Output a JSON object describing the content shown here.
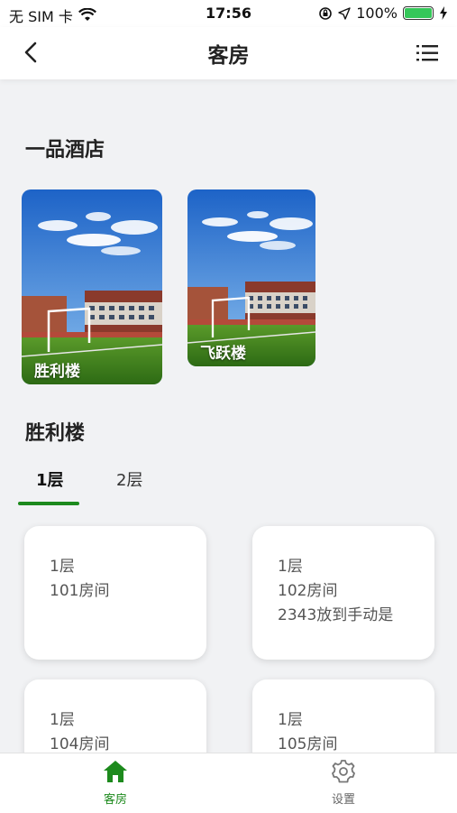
{
  "status_bar": {
    "carrier": "无 SIM 卡",
    "time": "17:56",
    "battery_percent": "100%",
    "battery_level": 1.0,
    "icons": [
      "wifi-icon",
      "location-icon",
      "lock-rotation-icon",
      "battery-icon",
      "charging-icon"
    ]
  },
  "nav": {
    "title": "客房",
    "back_icon": "chevron-left-icon",
    "menu_icon": "list-menu-icon"
  },
  "hotel": {
    "name": "一品酒店"
  },
  "buildings": [
    {
      "name": "胜利楼",
      "selected": true
    },
    {
      "name": "飞跃楼",
      "selected": false
    }
  ],
  "section": {
    "title": "胜利楼"
  },
  "floor_tabs": [
    {
      "label": "1层",
      "active": true
    },
    {
      "label": "2层",
      "active": false
    }
  ],
  "rooms": [
    {
      "floor": "1层",
      "name": "101房间",
      "note": ""
    },
    {
      "floor": "1层",
      "name": "102房间",
      "note": "2343放到手动是"
    },
    {
      "floor": "1层",
      "name": "104房间",
      "note": ""
    },
    {
      "floor": "1层",
      "name": "105房间",
      "note": ""
    }
  ],
  "tabbar": {
    "items": [
      {
        "label": "客房",
        "icon": "home-icon",
        "active": true
      },
      {
        "label": "设置",
        "icon": "gear-icon",
        "active": false
      }
    ]
  },
  "colors": {
    "accent": "#1d8a1d",
    "background": "#f1f2f4",
    "inactive": "#666666"
  }
}
